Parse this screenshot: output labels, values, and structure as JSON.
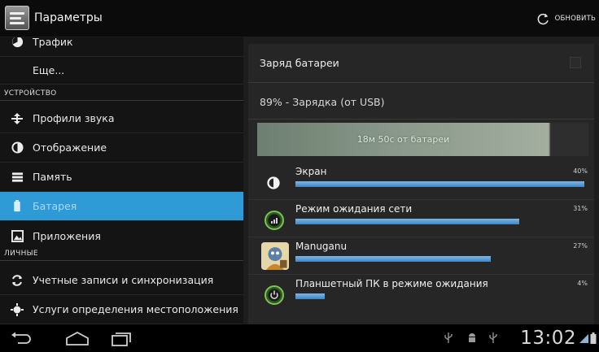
{
  "actionbar": {
    "title": "Параметры",
    "refresh_label": "ОБНОВИТЬ",
    "icon": "settings-app-icon"
  },
  "sidebar": {
    "items_top": [
      {
        "label": "Трафик",
        "icon": "data-usage-icon"
      },
      {
        "label": "Еще...",
        "icon": ""
      }
    ],
    "section_device": "УСТРОЙСТВО",
    "device_items": [
      {
        "label": "Профили звука",
        "icon": "sound-profile-icon"
      },
      {
        "label": "Отображение",
        "icon": "display-icon"
      },
      {
        "label": "Память",
        "icon": "storage-icon"
      },
      {
        "label": "Батарея",
        "icon": "battery-icon",
        "active": true
      },
      {
        "label": "Приложения",
        "icon": "apps-icon"
      }
    ],
    "section_personal": "ЛИЧНЫЕ",
    "personal_items": [
      {
        "label": "Учетные записи и синхронизация",
        "icon": "sync-icon"
      },
      {
        "label": "Услуги определения местоположения",
        "icon": "location-icon"
      }
    ]
  },
  "battery": {
    "charge_label": "Заряд батареи",
    "status": "89% - Зарядка (от USB)",
    "graph_label": "18м 50с от батареи",
    "graph_level": 0.88,
    "usage": [
      {
        "name": "Экран",
        "percent": "40%",
        "level": 0.4,
        "icon": "display-brightness-icon"
      },
      {
        "name": "Режим ожидания сети",
        "percent": "31%",
        "level": 0.31,
        "icon": "cell-standby-icon"
      },
      {
        "name": "Manuganu",
        "percent": "27%",
        "level": 0.27,
        "icon": "manuganu-app-icon"
      },
      {
        "name": "Планшетный ПК в режиме ожидания",
        "percent": "4%",
        "level": 0.04,
        "icon": "phone-idle-icon"
      }
    ]
  },
  "navbar": {
    "clock": "13:02",
    "buttons": [
      "back-icon",
      "home-icon",
      "recent-apps-icon"
    ]
  },
  "colors": {
    "accent": "#2f9bd6",
    "bar_blue": "#3c85c6",
    "graph_green": "#8b9a8c"
  }
}
